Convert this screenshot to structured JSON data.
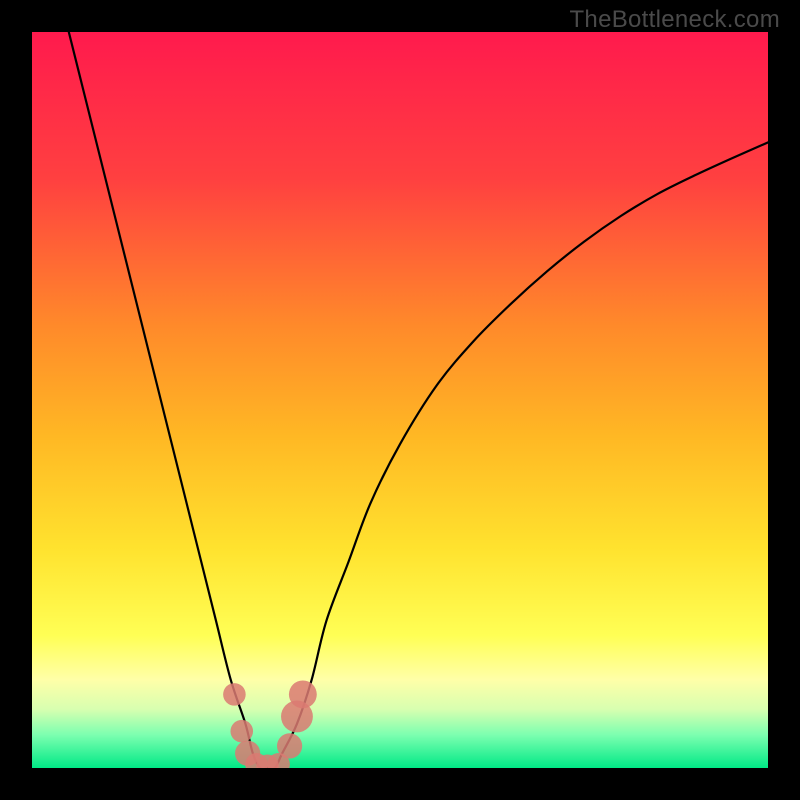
{
  "watermark": "TheBottleneck.com",
  "chart_data": {
    "type": "line",
    "title": "",
    "xlabel": "",
    "ylabel": "",
    "xlim": [
      0,
      100
    ],
    "ylim": [
      0,
      100
    ],
    "grid": false,
    "legend": false,
    "background": {
      "type": "vertical-gradient",
      "stops": [
        {
          "offset": 0.0,
          "color": "#ff1a4d"
        },
        {
          "offset": 0.2,
          "color": "#ff4040"
        },
        {
          "offset": 0.4,
          "color": "#ff8a2a"
        },
        {
          "offset": 0.55,
          "color": "#ffb824"
        },
        {
          "offset": 0.7,
          "color": "#ffe22e"
        },
        {
          "offset": 0.82,
          "color": "#ffff55"
        },
        {
          "offset": 0.88,
          "color": "#ffffa8"
        },
        {
          "offset": 0.92,
          "color": "#d8ffb0"
        },
        {
          "offset": 0.955,
          "color": "#7cffb0"
        },
        {
          "offset": 1.0,
          "color": "#00e986"
        }
      ]
    },
    "series": [
      {
        "name": "bottleneck-curve",
        "color": "#000000",
        "x": [
          5,
          7,
          9,
          11,
          13,
          15,
          17,
          19,
          21,
          23,
          25,
          27,
          29,
          30,
          31,
          32,
          33,
          34,
          36,
          38,
          40,
          43,
          46,
          50,
          55,
          60,
          65,
          70,
          75,
          80,
          85,
          90,
          95,
          100
        ],
        "y": [
          100,
          92,
          84,
          76,
          68,
          60,
          52,
          44,
          36,
          28,
          20,
          12,
          6,
          2,
          0,
          0,
          0,
          2,
          6,
          12,
          20,
          28,
          36,
          44,
          52,
          58,
          63,
          67.5,
          71.5,
          75,
          78,
          80.5,
          82.8,
          85
        ]
      }
    ],
    "markers": [
      {
        "name": "marker-left-upper",
        "x": 27.5,
        "y": 10,
        "r": 1.1,
        "color": "#db7a72"
      },
      {
        "name": "marker-left-mid",
        "x": 28.5,
        "y": 5,
        "r": 1.1,
        "color": "#db7a72"
      },
      {
        "name": "marker-left-low",
        "x": 29.3,
        "y": 2,
        "r": 1.3,
        "color": "#db7a72"
      },
      {
        "name": "marker-bottom-l",
        "x": 30.5,
        "y": 0.5,
        "r": 1.1,
        "color": "#db7a72"
      },
      {
        "name": "marker-bottom-c",
        "x": 32.0,
        "y": 0.3,
        "r": 1.1,
        "color": "#db7a72"
      },
      {
        "name": "marker-bottom-r",
        "x": 33.5,
        "y": 0.5,
        "r": 1.1,
        "color": "#db7a72"
      },
      {
        "name": "marker-right-low",
        "x": 35.0,
        "y": 3,
        "r": 1.3,
        "color": "#db7a72"
      },
      {
        "name": "marker-right-mid",
        "x": 36.0,
        "y": 7,
        "r": 1.8,
        "color": "#db7a72"
      },
      {
        "name": "marker-right-upper",
        "x": 36.8,
        "y": 10,
        "r": 1.5,
        "color": "#db7a72"
      }
    ]
  }
}
